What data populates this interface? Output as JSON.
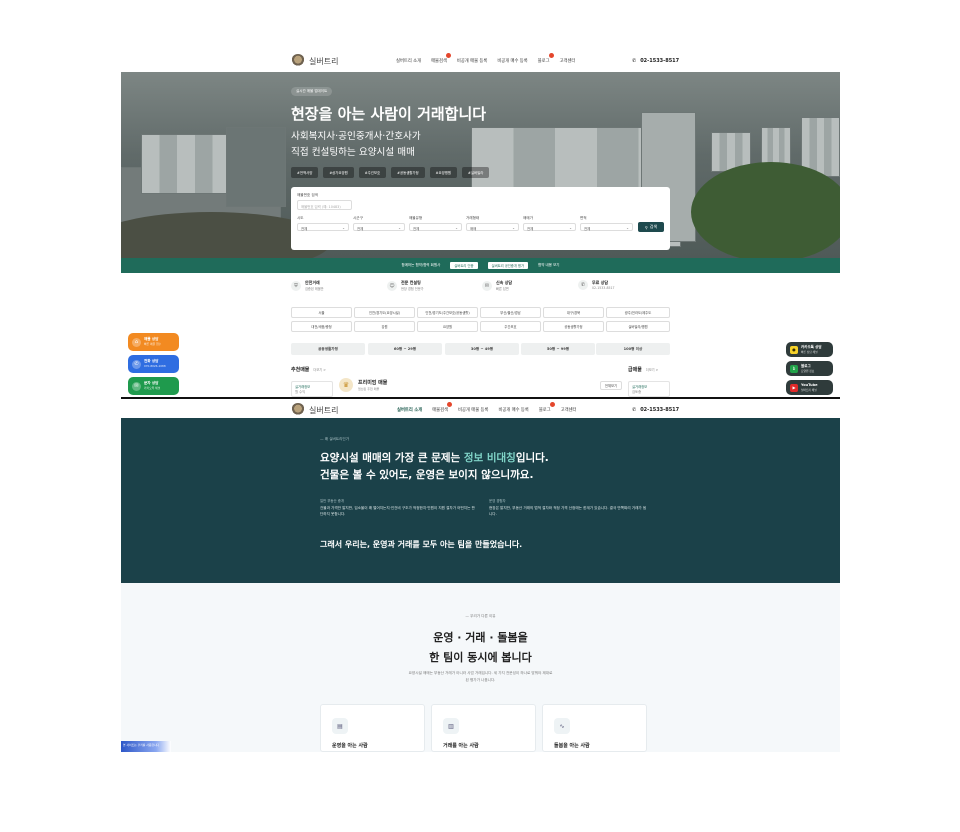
{
  "top_nav": {
    "brand": "실버트리",
    "menu": [
      "실버트리 소개",
      "매물검색",
      "비공개 매물 등록",
      "비공개 매수 등록",
      "블로그",
      "고객센터"
    ],
    "phone": "02-1533-8517"
  },
  "hero": {
    "badge": "실시간 매물 업데이트",
    "title": "현장을 아는 사람이 거래합니다",
    "subtitle_line1": "사회복지사·공인중개사·간호사가",
    "subtitle_line2": "직접 컨설팅하는 요양시설 매매",
    "tags": [
      "#전액사양",
      "#상가요양원",
      "#주건보호",
      "#공동생활가정",
      "#요양병원",
      "#실버빌라"
    ]
  },
  "search": {
    "keyword_label": "매물번호 검색",
    "keyword_placeholder": "매물번호 입력 (예: 10483)",
    "button": "검색",
    "filters": [
      {
        "label": "시도",
        "value": "전체"
      },
      {
        "label": "시군구",
        "value": "전체"
      },
      {
        "label": "매물유형",
        "value": "전체"
      },
      {
        "label": "거래형태",
        "value": "매매"
      },
      {
        "label": "매매가",
        "value": "전체"
      },
      {
        "label": "면적",
        "value": "전체"
      }
    ]
  },
  "green_bar": {
    "left": "함께하는 협약/협력 회원사",
    "chip1": "실버트리 인증",
    "chip2": "실버트리 공인중개 평가",
    "right": "협약 내용 보기"
  },
  "services": [
    {
      "title": "안전거래",
      "sub": "검증된 매물만"
    },
    {
      "title": "전문 컨설팅",
      "sub": "현장 경험 전문가"
    },
    {
      "title": "신속 상담",
      "sub": "빠른 답변"
    },
    {
      "title": "무료 상담",
      "sub": "02-1533-8517"
    }
  ],
  "categories": [
    "서울",
    "인천/경기도(요양시설)",
    "인천/경기도(주간보호/공동생활)",
    "부산/울산/경남",
    "대구/경북",
    "광주/전라도/제주도",
    "대전/세종/충청",
    "강원",
    "요양원",
    "주간보호",
    "공동생활가정",
    "실버빌라/병원"
  ],
  "areas": [
    "공동생활가정",
    "60평 ~ 29평",
    "30평 ~ 49평",
    "50평 ~ 99평",
    "100평 이상"
  ],
  "listings": {
    "recommend_title": "추천매물",
    "recommend_more": "더보기 >",
    "premium_label": "프리미엄 매물",
    "premium_sub": "엄선된 추천 매물",
    "card_tag": "요양원",
    "card_title": "실거래정보",
    "card_status": "검토중",
    "card_meta": "월 수익",
    "urgent_title": "급매물",
    "urgent_more": "더보기 >",
    "urgent_badge": "전체보기"
  },
  "float_left": [
    {
      "title": "매물 상담",
      "sub": "빠른 매물 접수",
      "color": "#f28a21"
    },
    {
      "title": "전화 상담",
      "sub": "070-8026-1088",
      "color": "#2f6de1"
    },
    {
      "title": "문자 상담",
      "sub": "카카오톡 채널",
      "color": "#1f9a4d"
    }
  ],
  "float_right": [
    {
      "title": "카카오톡 상담",
      "sub": "빠른 상담 채널",
      "color": "#f7d32a"
    },
    {
      "title": "블로그",
      "sub": "요양원 정보",
      "color": "#22a34a"
    },
    {
      "title": "YouTube",
      "sub": "실버트리 채널",
      "color": "#e02a2a"
    }
  ],
  "about": {
    "eyebrow": "왜 실버트리인가",
    "headline_pre": "요양시설 매매의 가장 큰 문제는 ",
    "headline_hl": "정보 비대칭",
    "headline_post": "입니다.",
    "headline2": "건물은 볼 수 있어도, 운영은 보이지 않으니까요.",
    "col1_head": "일반 부동산 중개",
    "col1_body": "건물과 가격만 알지만, 입소율이 왜 떨어지는지·인건비 구조가 적정한지·민원이 지원 절차가 어떤지는 판단하지 못합니다.",
    "col2_head": "운영 경험자",
    "col2_body": "현장은 알지만, 부동산 거래의 법적 절차와 적정 가격 산정에는 한계가 있습니다. 결국 반쪽짜리 거래가 됩니다.",
    "conclusion": "그래서 우리는, 운영과 거래를 모두 아는 팀을 만들었습니다."
  },
  "team": {
    "eyebrow": "우리가 다른 이유",
    "title1": "운영 · 거래 · 돌봄을",
    "title2": "한 팀이 동시에 봅니다",
    "desc1": "요양시설 매매는 부동산 거래가 아니라 사업 거래입니다. 세 가지 전문성이 하나로 맞춰야 제대로",
    "desc2": "된 평가가 나옵니다.",
    "cards": [
      "운영을 아는 사람",
      "거래를 아는 사람",
      "돌봄을 아는 사람"
    ]
  },
  "cookie_notice": "본 사이트는 쿠키를 사용합니다"
}
